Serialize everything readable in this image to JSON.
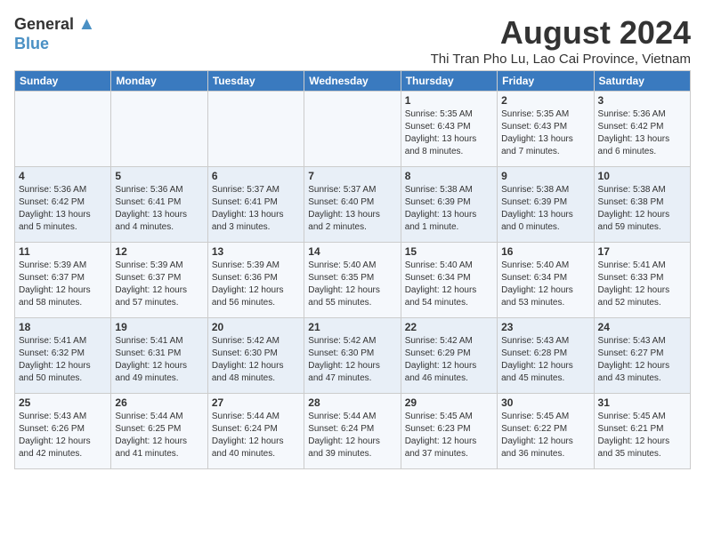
{
  "header": {
    "logo_general": "General",
    "logo_blue": "Blue",
    "month_title": "August 2024",
    "subtitle": "Thi Tran Pho Lu, Lao Cai Province, Vietnam"
  },
  "weekdays": [
    "Sunday",
    "Monday",
    "Tuesday",
    "Wednesday",
    "Thursday",
    "Friday",
    "Saturday"
  ],
  "weeks": [
    [
      {
        "day": "",
        "info": ""
      },
      {
        "day": "",
        "info": ""
      },
      {
        "day": "",
        "info": ""
      },
      {
        "day": "",
        "info": ""
      },
      {
        "day": "1",
        "info": "Sunrise: 5:35 AM\nSunset: 6:43 PM\nDaylight: 13 hours\nand 8 minutes."
      },
      {
        "day": "2",
        "info": "Sunrise: 5:35 AM\nSunset: 6:43 PM\nDaylight: 13 hours\nand 7 minutes."
      },
      {
        "day": "3",
        "info": "Sunrise: 5:36 AM\nSunset: 6:42 PM\nDaylight: 13 hours\nand 6 minutes."
      }
    ],
    [
      {
        "day": "4",
        "info": "Sunrise: 5:36 AM\nSunset: 6:42 PM\nDaylight: 13 hours\nand 5 minutes."
      },
      {
        "day": "5",
        "info": "Sunrise: 5:36 AM\nSunset: 6:41 PM\nDaylight: 13 hours\nand 4 minutes."
      },
      {
        "day": "6",
        "info": "Sunrise: 5:37 AM\nSunset: 6:41 PM\nDaylight: 13 hours\nand 3 minutes."
      },
      {
        "day": "7",
        "info": "Sunrise: 5:37 AM\nSunset: 6:40 PM\nDaylight: 13 hours\nand 2 minutes."
      },
      {
        "day": "8",
        "info": "Sunrise: 5:38 AM\nSunset: 6:39 PM\nDaylight: 13 hours\nand 1 minute."
      },
      {
        "day": "9",
        "info": "Sunrise: 5:38 AM\nSunset: 6:39 PM\nDaylight: 13 hours\nand 0 minutes."
      },
      {
        "day": "10",
        "info": "Sunrise: 5:38 AM\nSunset: 6:38 PM\nDaylight: 12 hours\nand 59 minutes."
      }
    ],
    [
      {
        "day": "11",
        "info": "Sunrise: 5:39 AM\nSunset: 6:37 PM\nDaylight: 12 hours\nand 58 minutes."
      },
      {
        "day": "12",
        "info": "Sunrise: 5:39 AM\nSunset: 6:37 PM\nDaylight: 12 hours\nand 57 minutes."
      },
      {
        "day": "13",
        "info": "Sunrise: 5:39 AM\nSunset: 6:36 PM\nDaylight: 12 hours\nand 56 minutes."
      },
      {
        "day": "14",
        "info": "Sunrise: 5:40 AM\nSunset: 6:35 PM\nDaylight: 12 hours\nand 55 minutes."
      },
      {
        "day": "15",
        "info": "Sunrise: 5:40 AM\nSunset: 6:34 PM\nDaylight: 12 hours\nand 54 minutes."
      },
      {
        "day": "16",
        "info": "Sunrise: 5:40 AM\nSunset: 6:34 PM\nDaylight: 12 hours\nand 53 minutes."
      },
      {
        "day": "17",
        "info": "Sunrise: 5:41 AM\nSunset: 6:33 PM\nDaylight: 12 hours\nand 52 minutes."
      }
    ],
    [
      {
        "day": "18",
        "info": "Sunrise: 5:41 AM\nSunset: 6:32 PM\nDaylight: 12 hours\nand 50 minutes."
      },
      {
        "day": "19",
        "info": "Sunrise: 5:41 AM\nSunset: 6:31 PM\nDaylight: 12 hours\nand 49 minutes."
      },
      {
        "day": "20",
        "info": "Sunrise: 5:42 AM\nSunset: 6:30 PM\nDaylight: 12 hours\nand 48 minutes."
      },
      {
        "day": "21",
        "info": "Sunrise: 5:42 AM\nSunset: 6:30 PM\nDaylight: 12 hours\nand 47 minutes."
      },
      {
        "day": "22",
        "info": "Sunrise: 5:42 AM\nSunset: 6:29 PM\nDaylight: 12 hours\nand 46 minutes."
      },
      {
        "day": "23",
        "info": "Sunrise: 5:43 AM\nSunset: 6:28 PM\nDaylight: 12 hours\nand 45 minutes."
      },
      {
        "day": "24",
        "info": "Sunrise: 5:43 AM\nSunset: 6:27 PM\nDaylight: 12 hours\nand 43 minutes."
      }
    ],
    [
      {
        "day": "25",
        "info": "Sunrise: 5:43 AM\nSunset: 6:26 PM\nDaylight: 12 hours\nand 42 minutes."
      },
      {
        "day": "26",
        "info": "Sunrise: 5:44 AM\nSunset: 6:25 PM\nDaylight: 12 hours\nand 41 minutes."
      },
      {
        "day": "27",
        "info": "Sunrise: 5:44 AM\nSunset: 6:24 PM\nDaylight: 12 hours\nand 40 minutes."
      },
      {
        "day": "28",
        "info": "Sunrise: 5:44 AM\nSunset: 6:24 PM\nDaylight: 12 hours\nand 39 minutes."
      },
      {
        "day": "29",
        "info": "Sunrise: 5:45 AM\nSunset: 6:23 PM\nDaylight: 12 hours\nand 37 minutes."
      },
      {
        "day": "30",
        "info": "Sunrise: 5:45 AM\nSunset: 6:22 PM\nDaylight: 12 hours\nand 36 minutes."
      },
      {
        "day": "31",
        "info": "Sunrise: 5:45 AM\nSunset: 6:21 PM\nDaylight: 12 hours\nand 35 minutes."
      }
    ]
  ]
}
